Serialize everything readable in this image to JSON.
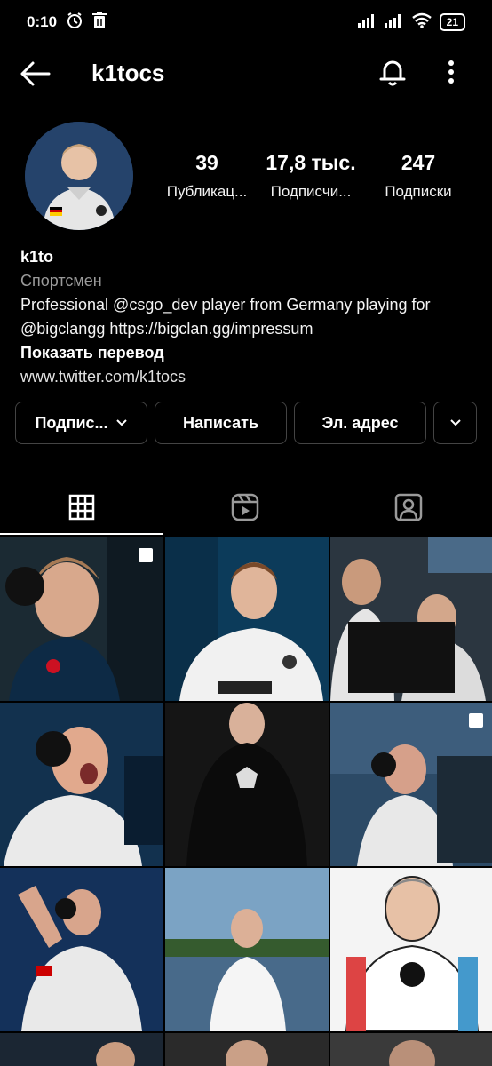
{
  "status_bar": {
    "time": "0:10",
    "battery": "21"
  },
  "header": {
    "username": "k1tocs"
  },
  "profile": {
    "stats": [
      {
        "value": "39",
        "label": "Публикац..."
      },
      {
        "value": "17,8 тыс.",
        "label": "Подписчи..."
      },
      {
        "value": "247",
        "label": "Подписки"
      }
    ],
    "name": "k1to",
    "category": "Спортсмен",
    "bio_line1": "Professional @csgo_dev player from Germany playing for",
    "bio_line2": "@bigclangg https://bigclan.gg/impressum",
    "translate_label": "Показать перевод",
    "website": "www.twitter.com/k1tocs"
  },
  "actions": {
    "subscribe_label": "Подпис...",
    "message_label": "Написать",
    "email_label": "Эл. адрес"
  },
  "tabs": [
    "grid-icon",
    "reels-icon",
    "tagged-icon"
  ],
  "colors": {
    "background": "#000000",
    "text": "#ffffff",
    "muted": "#9a9a9a",
    "button_border": "#444444"
  }
}
